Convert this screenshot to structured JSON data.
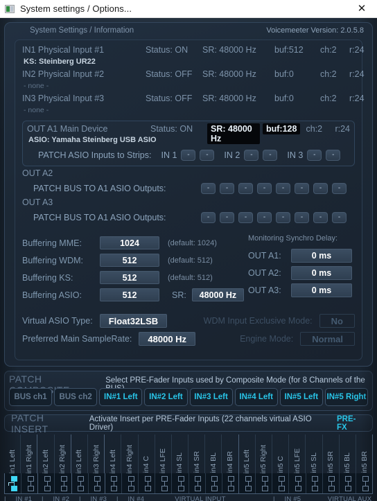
{
  "titlebar": {
    "title": "System settings / Options...",
    "icon": "app-window-icon",
    "close_label": "✕"
  },
  "settings": {
    "header": "System Settings / Information",
    "version": "Voicemeeter Version: 2.0.5.8"
  },
  "devices": [
    {
      "name": "IN1 Physical Input #1",
      "status": "Status: ON",
      "sr": "SR: 48000 Hz",
      "buf": "buf:512",
      "ch": "ch:2",
      "r": "r:24",
      "sub": "KS: Steinberg UR22",
      "sub_dim": false,
      "highlight": false
    },
    {
      "name": "IN2 Physical Input #2",
      "status": "Status: OFF",
      "sr": "SR: 48000 Hz",
      "buf": "buf:0",
      "ch": "ch:2",
      "r": "r:24",
      "sub": "- none -",
      "sub_dim": true,
      "highlight": false
    },
    {
      "name": "IN3 Physical Input #3",
      "status": "Status: OFF",
      "sr": "SR: 48000 Hz",
      "buf": "buf:0",
      "ch": "ch:2",
      "r": "r:24",
      "sub": "- none -",
      "sub_dim": true,
      "highlight": false
    }
  ],
  "out_a1": {
    "name": "OUT A1 Main Device",
    "status": "Status: ON",
    "sr": "SR: 48000 Hz",
    "buf": "buf:128",
    "ch": "ch:2",
    "r": "r:24",
    "sub": "ASIO: Yamaha Steinberg USB ASIO",
    "patch_label": "PATCH ASIO Inputs to Strips:",
    "in_tags": [
      "IN 1",
      "IN 2",
      "IN 3"
    ],
    "patch_btn_label": "-"
  },
  "out_a2": {
    "name": "OUT A2",
    "patch_label": "PATCH BUS TO A1 ASIO Outputs:",
    "buttons": [
      "-",
      "-",
      "-",
      "-",
      "-",
      "-",
      "-",
      "-"
    ]
  },
  "out_a3": {
    "name": "OUT A3",
    "patch_label": "PATCH BUS TO A1 ASIO Outputs:",
    "buttons": [
      "-",
      "-",
      "-",
      "-",
      "-",
      "-",
      "-",
      "-"
    ]
  },
  "buffering": [
    {
      "label": "Buffering MME:",
      "value": "1024",
      "default": "(default: 1024)"
    },
    {
      "label": "Buffering WDM:",
      "value": "512",
      "default": "(default: 512)"
    },
    {
      "label": "Buffering KS:",
      "value": "512",
      "default": "(default: 512)"
    },
    {
      "label": "Buffering ASIO:",
      "value": "512",
      "default": ""
    }
  ],
  "asio_sr": {
    "label": "SR:",
    "value": "48000 Hz"
  },
  "monitoring": {
    "title": "Monitoring Synchro Delay:",
    "rows": [
      {
        "label": "OUT A1:",
        "value": "0 ms"
      },
      {
        "label": "OUT A2:",
        "value": "0 ms"
      },
      {
        "label": "OUT A3:",
        "value": "0 ms"
      }
    ]
  },
  "virtual_asio": {
    "label": "Virtual ASIO Type:",
    "value": "Float32LSB"
  },
  "preferred_sr": {
    "label": "Preferred Main SampleRate:",
    "value": "48000 Hz"
  },
  "wdm_exclusive": {
    "label": "WDM Input Exclusive Mode:",
    "value": "No"
  },
  "engine_mode": {
    "label": "Engine Mode:",
    "value": "Normal"
  },
  "composite": {
    "title": "PATCH COMPOSITE",
    "description": "Select PRE-Fader Inputs used by Composite Mode (for 8 Channels of the BUS)",
    "buttons": [
      {
        "label": "BUS ch1",
        "active": false
      },
      {
        "label": "BUS ch2",
        "active": false
      },
      {
        "label": "IN#1 Left",
        "active": true
      },
      {
        "label": "IN#2 Left",
        "active": true
      },
      {
        "label": "IN#3 Left",
        "active": true
      },
      {
        "label": "IN#4 Left",
        "active": true
      },
      {
        "label": "IN#5 Left",
        "active": true
      },
      {
        "label": "IN#5 Right",
        "active": true
      }
    ]
  },
  "insert": {
    "title": "PATCH INSERT",
    "description": "Activate Insert per PRE-Fader Inputs (22 channels virtual ASIO Driver)",
    "prefx": "PRE-FX"
  },
  "channels": [
    {
      "label": "in1 Left",
      "on": true,
      "group_end": false
    },
    {
      "label": "in1 Right",
      "on": false,
      "group_end": true
    },
    {
      "label": "in2 Left",
      "on": false,
      "group_end": false
    },
    {
      "label": "in2 Right",
      "on": false,
      "group_end": true
    },
    {
      "label": "in3 Left",
      "on": false,
      "group_end": false
    },
    {
      "label": "in3 Right",
      "on": false,
      "group_end": true
    },
    {
      "label": "in4 Left",
      "on": false,
      "group_end": false
    },
    {
      "label": "in4 Right",
      "on": false,
      "group_end": false
    },
    {
      "label": "in4 C",
      "on": false,
      "group_end": false
    },
    {
      "label": "in4 LFE",
      "on": false,
      "group_end": false
    },
    {
      "label": "in4 SL",
      "on": false,
      "group_end": false
    },
    {
      "label": "in4 SR",
      "on": false,
      "group_end": false
    },
    {
      "label": "in4 BL",
      "on": false,
      "group_end": false
    },
    {
      "label": "in4 BR",
      "on": false,
      "group_end": true
    },
    {
      "label": "in5 Left",
      "on": false,
      "group_end": false
    },
    {
      "label": "in5 Right",
      "on": false,
      "group_end": false
    },
    {
      "label": "in5 C",
      "on": false,
      "group_end": false
    },
    {
      "label": "in5 LFE",
      "on": false,
      "group_end": false
    },
    {
      "label": "in5 SL",
      "on": false,
      "group_end": false
    },
    {
      "label": "in5 SR",
      "on": false,
      "group_end": false
    },
    {
      "label": "in5 BL",
      "on": false,
      "group_end": false
    },
    {
      "label": "in5 BR",
      "on": false,
      "group_end": true
    }
  ],
  "channel_footer": [
    {
      "text": "|__ IN #1 __|",
      "span": 2
    },
    {
      "text": "__ IN #2 __|",
      "span": 2
    },
    {
      "text": "__ IN #3 __|",
      "span": 2
    },
    {
      "text": "__ IN #4 _______ VIRTUAL INPUT ____________|",
      "span": 8
    },
    {
      "text": "__ IN #5 ______ VIRTUAL AUX ____________|",
      "span": 8
    }
  ],
  "colors": {
    "accent_cyan": "#29c5e8",
    "panel_bg": "#1e2b3a",
    "text_dim": "#7d93aa",
    "text_bright": "#ffffff"
  }
}
